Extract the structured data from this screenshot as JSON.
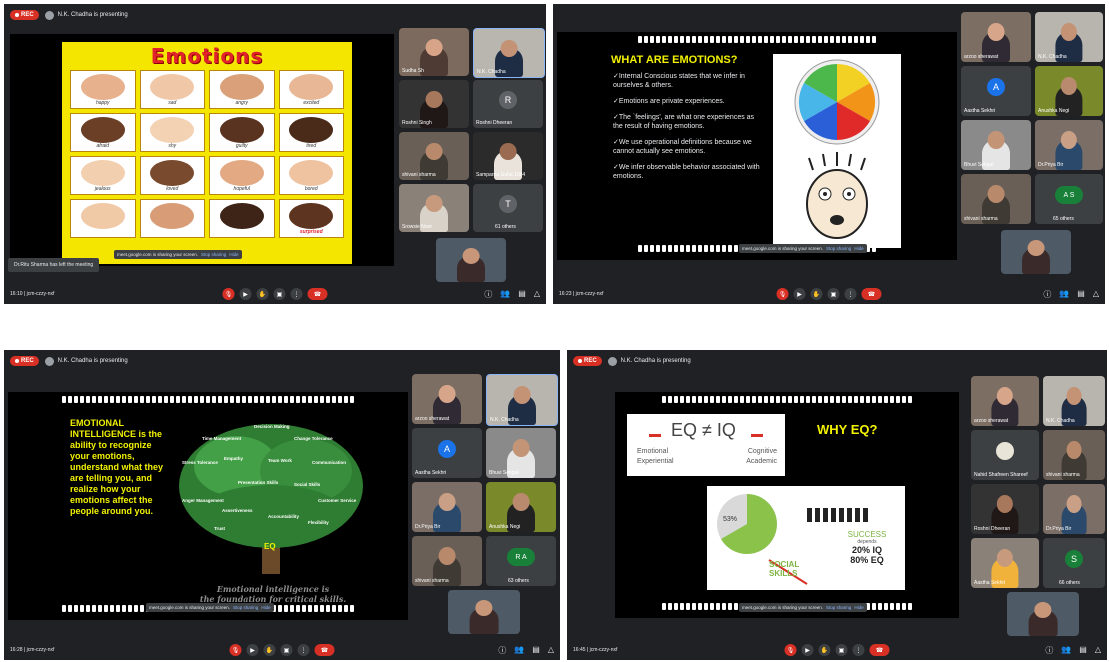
{
  "panels": [
    {
      "rec_label": "REC",
      "presenting": "N.K. Chadha is presenting",
      "meeting_info": "16:10 | jcm-czzy-nxf",
      "slide_title": "Emotions",
      "emotion_labels": [
        "happy",
        "sad",
        "angry",
        "excited",
        "afraid",
        "shy",
        "guilty",
        "tired",
        "jealous",
        "loved",
        "hopeful",
        "bored",
        "",
        "",
        "",
        "surprised"
      ],
      "notification": "Dr.Ritu Sharma has left the meeting",
      "toast": {
        "text": "meet.google.com is sharing your screen.",
        "stop": "Stop sharing",
        "hide": "Hide"
      },
      "participants": [
        {
          "name": "Sudha Sh",
          "avatar": ""
        },
        {
          "name": "N.K. Chadha",
          "avatar": ""
        },
        {
          "name": "Roshni Singh",
          "avatar": ""
        },
        {
          "name": "Roshni Dheeran",
          "avatar": "R"
        },
        {
          "name": "shivani sharma",
          "avatar": ""
        },
        {
          "name": "Samparna Guha 1084",
          "avatar": ""
        },
        {
          "name": "Srowsie Noor",
          "avatar": ""
        },
        {
          "name": "61 others",
          "avatar": "T"
        }
      ]
    },
    {
      "meeting_info": "16:23 | jcm-czzy-nxf",
      "slide_title": "WHAT ARE EMOTIONS?",
      "bullets": [
        "✓Internal Conscious states that we infer in ourselves & others.",
        "✓Emotions are private experiences.",
        "✓The `feelings', are what one experiences as the result of having emotions.",
        "✓We use operational definitions because we cannot actually see emotions.",
        "✓We infer observable behavior associated with emotions."
      ],
      "toast": {
        "text": "meet.google.com is sharing your screen.",
        "stop": "Stop sharing",
        "hide": "Hide"
      },
      "participants": [
        {
          "name": "arzoo sherawat",
          "avatar": ""
        },
        {
          "name": "N.K. Chadha",
          "avatar": ""
        },
        {
          "name": "Aastha Sekhri",
          "avatar": "A"
        },
        {
          "name": "Anushka Negi",
          "avatar": ""
        },
        {
          "name": "Bhuvi Sehgal",
          "avatar": ""
        },
        {
          "name": "Dr.Priya Bir",
          "avatar": ""
        },
        {
          "name": "shivani sharma",
          "avatar": ""
        },
        {
          "name": "65 others",
          "avatar": "A S"
        }
      ]
    },
    {
      "rec_label": "REC",
      "presenting": "N.K. Chadha is presenting",
      "meeting_info": "16:28 | jcm-czzy-nxf",
      "ei_text": "EMOTIONAL INTELLIGENCE is the ability to recognize your emotions, understand what they are telling you, and realize how your emotions affect the people around you.",
      "tree_words": [
        "Decision Making",
        "Time Management",
        "Change Tolerance",
        "Stress Tolerance",
        "Empathy",
        "Team Work",
        "Communication",
        "Presentation Skills",
        "Social Skills",
        "Anger Management",
        "Assertiveness",
        "Customer Service",
        "Accountability",
        "Flexibility",
        "Trust",
        "EQ"
      ],
      "tagline_1": "Emotional intelligence is",
      "tagline_2": "the foundation for critical skills.",
      "toast": {
        "text": "meet.google.com is sharing your screen.",
        "stop": "Stop sharing",
        "hide": "Hide"
      },
      "participants": [
        {
          "name": "arzoo sherawat",
          "avatar": ""
        },
        {
          "name": "N.K. Chadha",
          "avatar": ""
        },
        {
          "name": "Aastha Sekhri",
          "avatar": "A"
        },
        {
          "name": "Bhuvi Sehgal",
          "avatar": ""
        },
        {
          "name": "Dr.Priya Bir",
          "avatar": ""
        },
        {
          "name": "Anushka Negi",
          "avatar": ""
        },
        {
          "name": "shivani sharma",
          "avatar": ""
        },
        {
          "name": "63 others",
          "avatar": "R A"
        }
      ]
    },
    {
      "rec_label": "REC",
      "presenting": "N.K. Chadha is presenting",
      "meeting_info": "16:45 | jcm-czzy-nxf",
      "eq_formula": "EQ ≠ IQ",
      "emotional": "Emotional",
      "experiential": "Experiential",
      "cognitive": "Cognitive",
      "academic": "Academic",
      "why_eq": "WHY EQ?",
      "success": "SUCCESS",
      "depends": "depends",
      "iq_pct": "20% IQ",
      "eq_pct": "80% EQ",
      "social_skills": "SOCIAL SKILLS",
      "pie_pct": "53%",
      "toast": {
        "text": "meet.google.com is sharing your screen.",
        "stop": "Stop sharing",
        "hide": "Hide"
      },
      "participants": [
        {
          "name": "arzoo sherawat",
          "avatar": ""
        },
        {
          "name": "N.K. Chadha",
          "avatar": ""
        },
        {
          "name": "Nahid Shafreen Shareef",
          "avatar": ""
        },
        {
          "name": "shivani sharma",
          "avatar": ""
        },
        {
          "name": "Roshni Dheeran",
          "avatar": ""
        },
        {
          "name": "Dr.Priya Bir",
          "avatar": ""
        },
        {
          "name": "Aastha Sekhri",
          "avatar": ""
        },
        {
          "name": "66 others",
          "avatar": "S"
        }
      ]
    }
  ]
}
